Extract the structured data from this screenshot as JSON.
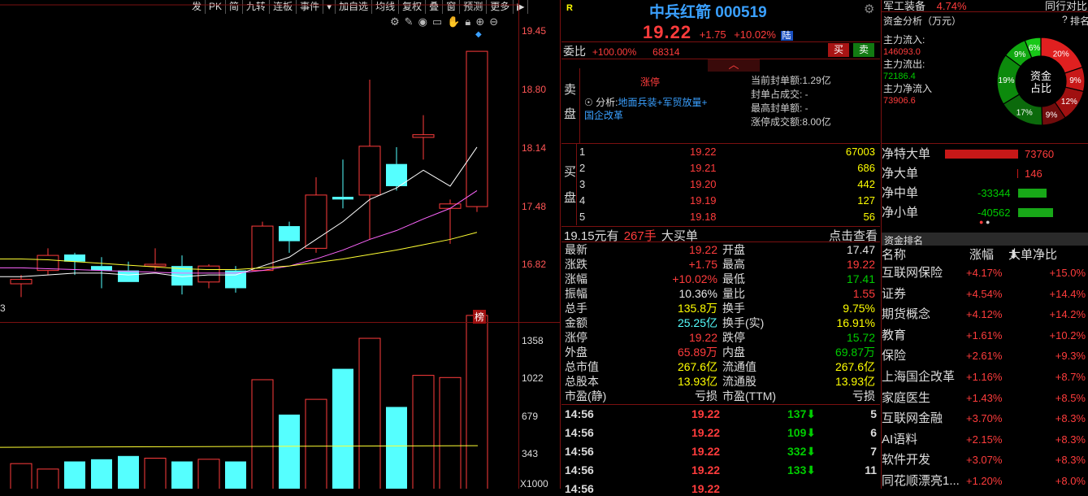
{
  "toolbar": [
    "发",
    "PK",
    "简",
    "九转",
    "连板",
    "事件",
    "▾",
    "加自选",
    "均线",
    "复权",
    "叠",
    "窗",
    "预测",
    "更多",
    "▶"
  ],
  "chart": {
    "price_ticks": [
      "19.45",
      "18.80",
      "18.14",
      "17.48",
      "16.82"
    ],
    "volume_ticks": [
      "1358",
      "1022",
      "679",
      "343"
    ],
    "volume_unit": "X1000",
    "left_label": "3",
    "rank_badge": "榜",
    "chart_data": {
      "type": "candlestick",
      "candles": [
        {
          "o": 16.6,
          "h": 16.7,
          "l": 16.45,
          "c": 16.65
        },
        {
          "o": 16.75,
          "h": 17.0,
          "l": 16.7,
          "c": 16.92
        },
        {
          "o": 16.93,
          "h": 16.95,
          "l": 16.7,
          "c": 16.85
        },
        {
          "o": 16.8,
          "h": 16.9,
          "l": 16.55,
          "c": 16.75
        },
        {
          "o": 16.75,
          "h": 16.85,
          "l": 16.62,
          "c": 16.62
        },
        {
          "o": 16.8,
          "h": 17.0,
          "l": 16.75,
          "c": 16.82
        },
        {
          "o": 16.8,
          "h": 16.92,
          "l": 16.48,
          "c": 16.58
        },
        {
          "o": 16.62,
          "h": 16.82,
          "l": 16.55,
          "c": 16.8
        },
        {
          "o": 16.75,
          "h": 16.8,
          "l": 16.5,
          "c": 16.55
        },
        {
          "o": 16.75,
          "h": 17.3,
          "l": 16.75,
          "c": 17.25
        },
        {
          "o": 17.25,
          "h": 17.3,
          "l": 16.95,
          "c": 17.08
        },
        {
          "o": 17.0,
          "h": 17.8,
          "l": 16.95,
          "c": 17.6
        },
        {
          "o": 17.58,
          "h": 18.0,
          "l": 17.45,
          "c": 17.55
        },
        {
          "o": 17.6,
          "h": 18.9,
          "l": 17.1,
          "c": 18.15
        },
        {
          "o": 17.95,
          "h": 18.14,
          "l": 17.65,
          "c": 17.7
        },
        {
          "o": 18.25,
          "h": 18.5,
          "l": 18.0,
          "c": 18.28
        },
        {
          "o": 17.45,
          "h": 17.55,
          "l": 17.05,
          "c": 17.5
        },
        {
          "o": 17.47,
          "h": 19.22,
          "l": 17.41,
          "c": 19.22
        }
      ],
      "ma": {
        "white": [
          16.68,
          16.7,
          16.72,
          16.72,
          16.7,
          16.72,
          16.68,
          16.7,
          16.7,
          16.8,
          16.9,
          17.1,
          17.3,
          17.55,
          17.68,
          17.88,
          17.7,
          18.14
        ],
        "magenta": [
          16.78,
          16.77,
          16.76,
          16.75,
          16.74,
          16.73,
          16.72,
          16.72,
          16.72,
          16.75,
          16.8,
          16.88,
          16.98,
          17.1,
          17.2,
          17.33,
          17.45,
          17.65
        ],
        "yellow": [
          16.88,
          16.87,
          16.85,
          16.83,
          16.81,
          16.79,
          16.77,
          16.76,
          16.76,
          16.78,
          16.8,
          16.84,
          16.88,
          16.93,
          16.98,
          17.04,
          17.1,
          17.18
        ]
      },
      "volumes": [
        230,
        180,
        250,
        270,
        300,
        280,
        250,
        270,
        250,
        1000,
        680,
        820,
        1100,
        1380,
        750,
        1040,
        1020,
        1590
      ],
      "vol_ma": 380,
      "ylim": [
        16.3,
        19.7
      ],
      "vol_max": 1650
    }
  },
  "quote": {
    "r_badge": "R",
    "name": "中兵红箭",
    "code": "000519",
    "price": "19.22",
    "change": "+1.75",
    "change_pct": "+10.02%",
    "lu_badge": "陆",
    "weibi_label": "委比",
    "weibi_value": "+100.00%",
    "weibi_vol": "68314",
    "buy_btn": "买",
    "sell_btn": "卖",
    "sell_side": [
      "卖",
      "盘"
    ],
    "limit_label": "涨停",
    "analysis_prefix": "分析:",
    "analysis_text": "地面兵装+军贸放量+",
    "analysis_text2": "国企改革",
    "seal_lines": [
      "当前封单额:1.29亿",
      "封单占成交: -",
      "最高封单额: -",
      "涨停成交额:8.00亿"
    ],
    "buy_side": [
      "买",
      "盘"
    ],
    "bids": [
      {
        "n": "1",
        "p": "19.22",
        "v": "67003"
      },
      {
        "n": "2",
        "p": "19.21",
        "v": "686"
      },
      {
        "n": "3",
        "p": "19.20",
        "v": "442"
      },
      {
        "n": "4",
        "p": "19.19",
        "v": "127"
      },
      {
        "n": "5",
        "p": "19.18",
        "v": "56"
      }
    ],
    "bigbuy_price": "19.15元有",
    "bigbuy_hands": "267手",
    "bigbuy_label": "大买单",
    "bigbuy_link": "点击查看",
    "stats": [
      {
        "l1": "最新",
        "v1": "19.22",
        "c1": "red",
        "l2": "开盘",
        "v2": "17.47",
        "c2": "wht"
      },
      {
        "l1": "涨跌",
        "v1": "+1.75",
        "c1": "red",
        "l2": "最高",
        "v2": "19.22",
        "c2": "red"
      },
      {
        "l1": "涨幅",
        "v1": "+10.02%",
        "c1": "red",
        "l2": "最低",
        "v2": "17.41",
        "c2": "green"
      },
      {
        "l1": "振幅",
        "v1": "10.36%",
        "c1": "wht",
        "l2": "量比",
        "v2": "1.55",
        "c2": "red"
      },
      {
        "l1": "总手",
        "v1": "135.8万",
        "c1": "yel",
        "l2": "换手",
        "v2": "9.75%",
        "c2": "yel"
      },
      {
        "l1": "金额",
        "v1": "25.25亿",
        "c1": "cyan",
        "l2": "换手(实)",
        "v2": "16.91%",
        "c2": "yel"
      },
      {
        "l1": "涨停",
        "v1": "19.22",
        "c1": "red",
        "l2": "跌停",
        "v2": "15.72",
        "c2": "green"
      },
      {
        "l1": "外盘",
        "v1": "65.89万",
        "c1": "red",
        "l2": "内盘",
        "v2": "69.87万",
        "c2": "green"
      },
      {
        "l1": "总市值",
        "v1": "267.6亿",
        "c1": "yel",
        "l2": "流通值",
        "v2": "267.6亿",
        "c2": "yel"
      },
      {
        "l1": "总股本",
        "v1": "13.93亿",
        "c1": "yel",
        "l2": "流通股",
        "v2": "13.93亿",
        "c2": "yel"
      },
      {
        "l1": "市盈(静)",
        "v1": "亏损",
        "c1": "wht",
        "l2": "市盈(TTM)",
        "v2": "亏损",
        "c2": "wht"
      }
    ],
    "ticks": [
      {
        "t": "14:56",
        "p": "19.22",
        "v": "137",
        "n": "5"
      },
      {
        "t": "14:56",
        "p": "19.22",
        "v": "109",
        "n": "6"
      },
      {
        "t": "14:56",
        "p": "19.22",
        "v": "332",
        "n": "7"
      },
      {
        "t": "14:56",
        "p": "19.22",
        "v": "133",
        "n": "11"
      },
      {
        "t": "14:56",
        "p": "19.22",
        "v": "",
        "n": ""
      }
    ]
  },
  "right": {
    "top_sector": "军工装备",
    "top_sector_pct": "4.74%",
    "top_sector_extra": "同行对比",
    "fund_title": "资金分析（万元）",
    "fund_q": "?",
    "fund_rank": "排名",
    "flow_in_label": "主力流入:",
    "flow_in": "146093.0",
    "flow_out_label": "主力流出:",
    "flow_out": "72186.4",
    "flow_net_label": "主力净流入",
    "flow_net": "73906.6",
    "donut_label1": "资金",
    "donut_label2": "占比",
    "donut": [
      {
        "pct": "20%",
        "v": 20,
        "color": "#e02020"
      },
      {
        "pct": "9%",
        "v": 9,
        "color": "#c81818"
      },
      {
        "pct": "12%",
        "v": 12,
        "color": "#a01010"
      },
      {
        "pct": "9%",
        "v": 9,
        "color": "#700c0c"
      },
      {
        "pct": "17%",
        "v": 17,
        "color": "#0c6a0c"
      },
      {
        "pct": "19%",
        "v": 19,
        "color": "#0c8a0c"
      },
      {
        "pct": "9%",
        "v": 9,
        "color": "#10a810"
      },
      {
        "pct": "6%",
        "v": 6,
        "color": "#18c818"
      }
    ],
    "flows": [
      {
        "label": "净特大单",
        "value": "73760",
        "color": "red",
        "bar": 1.0
      },
      {
        "label": "净大单",
        "value": "146",
        "color": "red",
        "bar": 0.01
      },
      {
        "label": "净中单",
        "value": "-33344",
        "color": "green",
        "bar": 0.45
      },
      {
        "label": "净小单",
        "value": "-40562",
        "color": "green",
        "bar": 0.55
      }
    ],
    "rank_title": "资金排名",
    "rank_headers": [
      "名称",
      "涨幅",
      "大单净比"
    ],
    "ranks": [
      {
        "name": "互联网保险",
        "chg": "+4.17%",
        "net": "+15.0%"
      },
      {
        "name": "证券",
        "chg": "+4.54%",
        "net": "+14.4%"
      },
      {
        "name": "期货概念",
        "chg": "+4.12%",
        "net": "+14.2%"
      },
      {
        "name": "教育",
        "chg": "+1.61%",
        "net": "+10.2%"
      },
      {
        "name": "保险",
        "chg": "+2.61%",
        "net": "+9.3%"
      },
      {
        "name": "上海国企改革",
        "chg": "+1.16%",
        "net": "+8.7%"
      },
      {
        "name": "家庭医生",
        "chg": "+1.43%",
        "net": "+8.5%"
      },
      {
        "name": "互联网金融",
        "chg": "+3.70%",
        "net": "+8.3%"
      },
      {
        "name": "AI语料",
        "chg": "+2.15%",
        "net": "+8.3%"
      },
      {
        "name": "软件开发",
        "chg": "+3.07%",
        "net": "+8.3%"
      },
      {
        "name": "同花顺漂亮1...",
        "chg": "+1.20%",
        "net": "+8.0%"
      }
    ]
  }
}
